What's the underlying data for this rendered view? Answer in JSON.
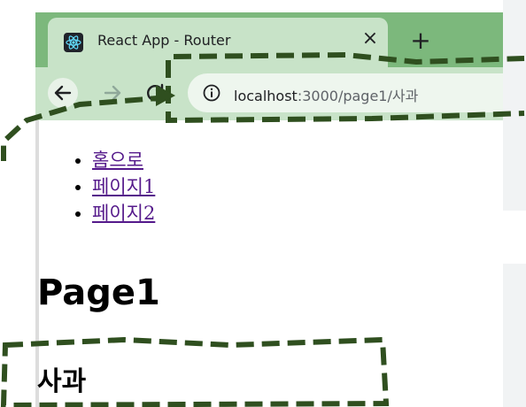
{
  "browser": {
    "tab_title": "React App - Router",
    "tab_close": "×",
    "new_tab": "+",
    "url_host": "localhost",
    "url_rest": ":3000/page1/사과",
    "icons": {
      "favicon": "react-logo-icon",
      "back": "arrow-left-icon",
      "forward": "arrow-right-icon",
      "reload": "reload-icon",
      "site_info": "info-icon"
    }
  },
  "nav": {
    "items": [
      {
        "label": "홈으로"
      },
      {
        "label": "페이지1"
      },
      {
        "label": "페이지2"
      }
    ]
  },
  "page": {
    "heading": "Page1",
    "subheading": "사과"
  },
  "colors": {
    "tab_strip": "#7cb87c",
    "toolbar": "#c8e3c8",
    "link": "#551a8b",
    "annotation": "#2f4f1f"
  }
}
